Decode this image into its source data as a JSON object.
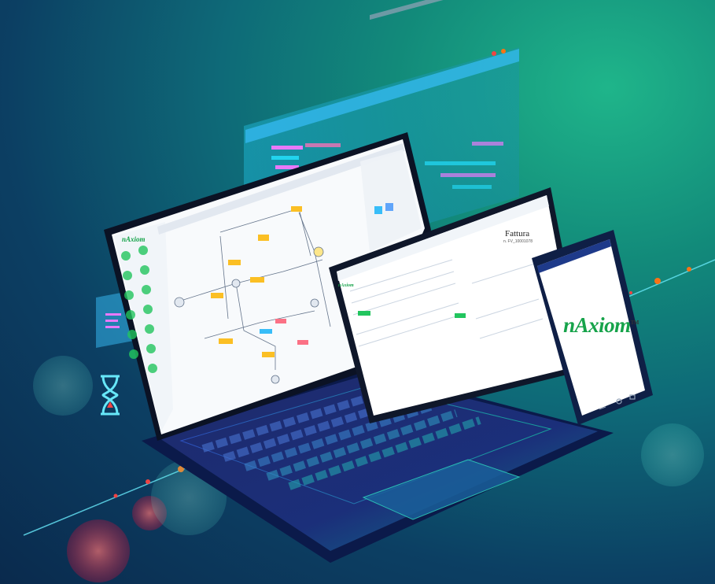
{
  "brand": {
    "logo_text": "nAxiom",
    "trademark": "TM",
    "accent": "#16a34a"
  },
  "tablet": {
    "doc_title": "Fattura",
    "doc_number": "n. FV_10001078"
  },
  "colors": {
    "bg_dark": "#0a2a4d",
    "bg_teal": "#128a7a",
    "bg_green": "#1fb58a",
    "code_pink": "#e879f9",
    "code_cyan": "#22d3ee",
    "code_orange": "#f59e0b",
    "bokeh_red": "#ef4444"
  },
  "icons": {
    "hourglass": "hourglass-icon",
    "window_dots": "window-dots-icon"
  }
}
